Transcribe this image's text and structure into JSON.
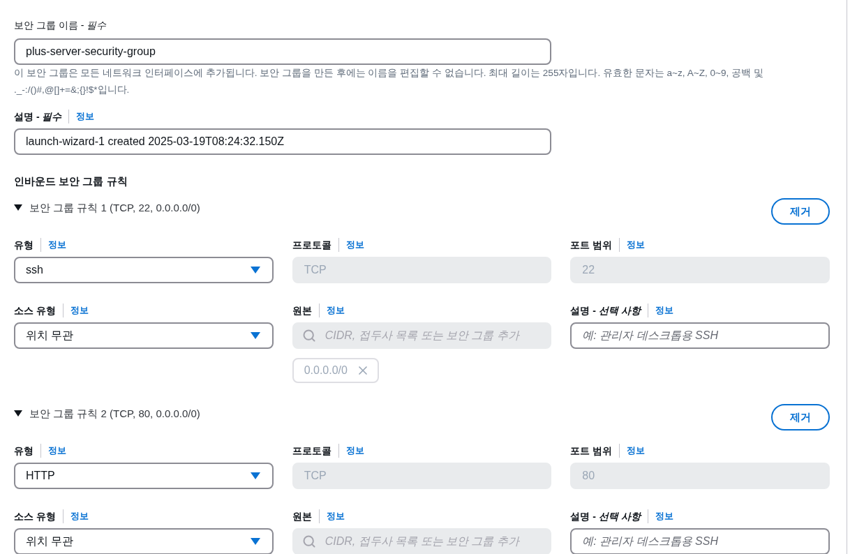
{
  "name_field": {
    "label": "보안 그룹 이름 - *필수*",
    "value": "plus-server-security-group",
    "help": "이 보안 그룹은 모든 네트워크 인터페이스에 추가됩니다. 보안 그룹을 만든 후에는 이름을 편집할 수 없습니다. 최대 길이는 255자입니다. 유효한 문자는 a~z, A~Z, 0~9, 공백 및 ._-:/()#,@[]+=&;{}!$*입니다."
  },
  "description_field": {
    "label": "설명 - *필수*",
    "info_link": "정보",
    "value": "launch-wizard-1 created 2025-03-19T08:24:32.150Z"
  },
  "inbound_rules": {
    "title": "인바운드 보안 그룹 규칙",
    "rules": [
      {
        "title": "보안 그룹 규칙 1 (TCP, 22, 0.0.0.0/0)",
        "expanded": true,
        "remove_button": "제거",
        "fields": [
          {
            "kind": "select",
            "label": "유형",
            "info_link": "정보",
            "value": "ssh",
            "disabled": false
          },
          {
            "kind": "input",
            "label": "프로토콜",
            "info_link": "정보",
            "value": "TCP",
            "disabled": true
          },
          {
            "kind": "input",
            "label": "포트 범위",
            "info_link": "정보",
            "value": "22",
            "disabled": true
          },
          {
            "kind": "select",
            "label": "소스 유형",
            "info_link": "정보",
            "value": "위치 무관",
            "disabled": false
          },
          {
            "kind": "search",
            "label": "원본",
            "info_link": "정보",
            "placeholder": "CIDR, 접두사 목록 또는 보안 그룹 추가",
            "disabled": true,
            "tokens": [
              "0.0.0.0/0"
            ]
          },
          {
            "kind": "input",
            "label": "설명 - *선택 사항*",
            "info_link": "정보",
            "placeholder": "예: 관리자 데스크톱용 SSH",
            "disabled": false
          }
        ]
      },
      {
        "title": "보안 그룹 규칙 2 (TCP, 80, 0.0.0.0/0)",
        "expanded": true,
        "remove_button": "제거",
        "fields": [
          {
            "kind": "select",
            "label": "유형",
            "info_link": "정보",
            "value": "HTTP",
            "disabled": false
          },
          {
            "kind": "input",
            "label": "프로토콜",
            "info_link": "정보",
            "value": "TCP",
            "disabled": true
          },
          {
            "kind": "input",
            "label": "포트 범위",
            "info_link": "정보",
            "value": "80",
            "disabled": true
          },
          {
            "kind": "select",
            "label": "소스 유형",
            "info_link": "정보",
            "value": "위치 무관",
            "disabled": false
          },
          {
            "kind": "search",
            "label": "원본",
            "info_link": "정보",
            "placeholder": "CIDR, 접두사 목록 또는 보안 그룹 추가",
            "disabled": true
          },
          {
            "kind": "input",
            "label": "설명 - *선택 사항*",
            "info_link": "정보",
            "placeholder": "예: 관리자 데스크톱용 SSH",
            "disabled": false
          }
        ]
      }
    ]
  }
}
